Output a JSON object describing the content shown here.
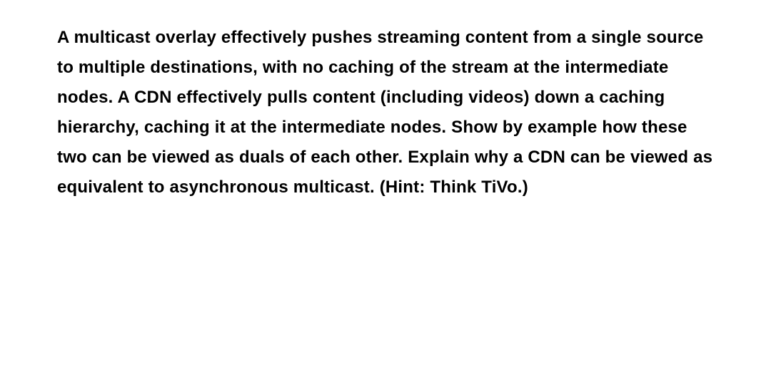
{
  "question": {
    "text": "A multicast overlay effectively pushes streaming content from a single source to multiple destinations, with no caching of the stream at the intermediate nodes. A CDN effectively pulls content (including videos) down a caching hierarchy, caching it at the intermediate nodes. Show by example how these two can be viewed as duals of each other. Explain why a CDN can be viewed as equivalent to asynchronous multicast. (Hint: Think TiVo.)"
  }
}
